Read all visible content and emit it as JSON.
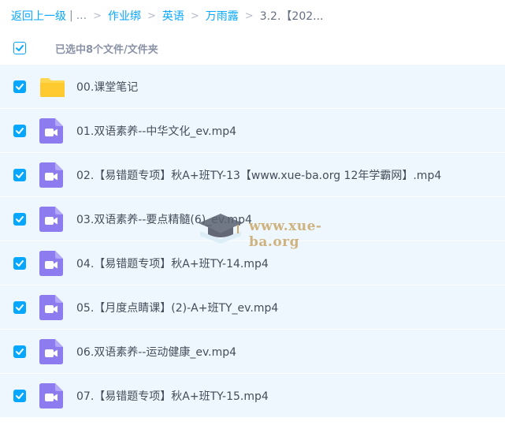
{
  "breadcrumb": {
    "back": "返回上一级",
    "bar": "|",
    "ellipsis": "...",
    "arrow": ">",
    "items": [
      "作业绑",
      "英语",
      "万雨露"
    ],
    "current": "3.2.【202..."
  },
  "selection": {
    "label": "已选中8个文件/文件夹"
  },
  "files": [
    {
      "name": "00.课堂笔记",
      "icon": "folder-icon"
    },
    {
      "name": "01.双语素养--中华文化_ev.mp4",
      "icon": "video-file-icon"
    },
    {
      "name": "02.【易错题专项】秋A+班TY-13【www.xue-ba.org 12年学霸网】.mp4",
      "icon": "video-file-icon"
    },
    {
      "name": "03.双语素养--要点精髓(6)_ev.mp4",
      "icon": "video-file-icon"
    },
    {
      "name": "04.【易错题专项】秋A+班TY-14.mp4",
      "icon": "video-file-icon"
    },
    {
      "name": "05.【月度点睛课】(2)-A+班TY_ev.mp4",
      "icon": "video-file-icon"
    },
    {
      "name": "06.双语素养--运动健康_ev.mp4",
      "icon": "video-file-icon"
    },
    {
      "name": "07.【易错题专项】秋A+班TY-15.mp4",
      "icon": "video-file-icon"
    }
  ],
  "watermark": {
    "text": "www.xue-ba.org"
  },
  "colors": {
    "accent": "#06a7ff",
    "row_bg": "#eef6fe",
    "video_icon": "#8c7cf0",
    "folder": "#ffd64f"
  }
}
